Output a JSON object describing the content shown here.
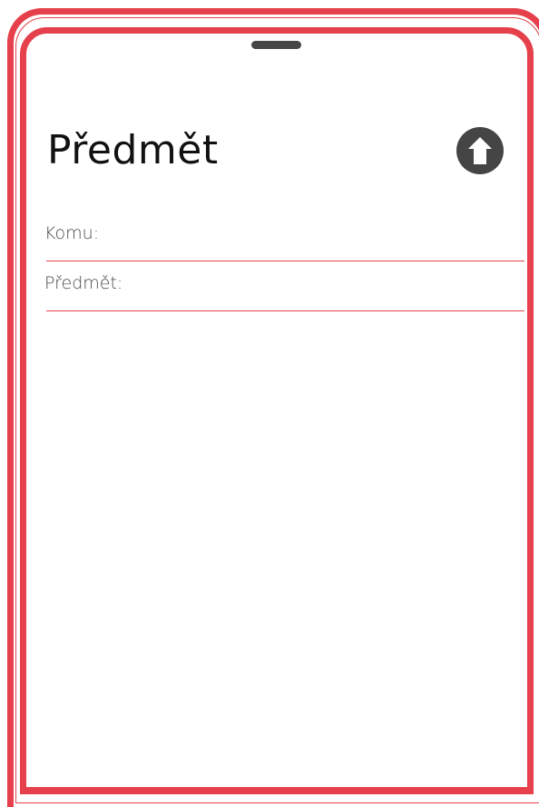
{
  "header": {
    "title": "Předmět",
    "send_button_icon": "arrow-up-circle-icon"
  },
  "form": {
    "to": {
      "label": "Komu:",
      "value": ""
    },
    "subject": {
      "label": "Předmět:",
      "value": ""
    }
  },
  "colors": {
    "accent": "#e5404b",
    "button": "#454545",
    "title": "#111111",
    "label": "#4a4a4a"
  }
}
